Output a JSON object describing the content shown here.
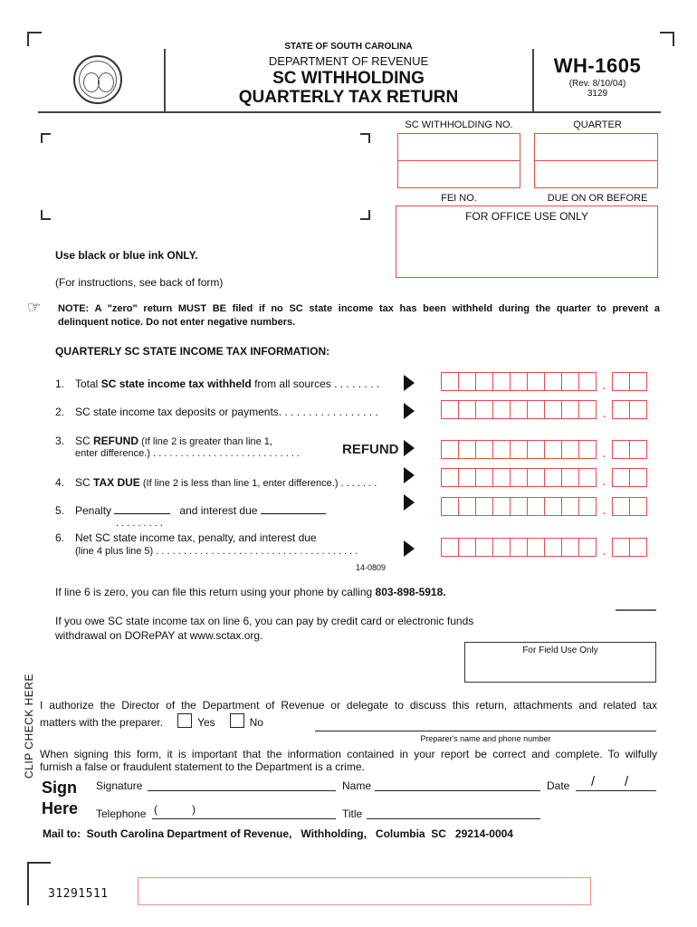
{
  "header": {
    "state": "STATE OF SOUTH CAROLINA",
    "department": "DEPARTMENT OF REVENUE",
    "title_line1": "SC WITHHOLDING",
    "title_line2": "QUARTERLY TAX RETURN",
    "form_number": "WH-1605",
    "revision": "(Rev. 8/10/04)",
    "form_code": "3129",
    "seal_icon": "sc-state-seal"
  },
  "id_boxes": {
    "withholding_no_label": "SC WITHHOLDING NO.",
    "quarter_label": "QUARTER",
    "fei_no_label": "FEI NO.",
    "due_date_label": "DUE ON OR BEFORE",
    "office_use_label": "FOR OFFICE USE ONLY",
    "withholding_no_value": "",
    "quarter_value": "",
    "fei_no_value": "",
    "due_date_value": ""
  },
  "instructions": {
    "ink": "Use black or blue ink ONLY.",
    "see_back": "(For instructions, see back of form)",
    "note_icon": "pointing-hand",
    "note_line1": "NOTE: A \"zero\" return MUST BE filed if no SC state income tax has been  withheld during the quarter to prevent a",
    "note_line2": "delinquent notice.  Do not enter negative numbers.",
    "section_title": "QUARTERLY SC STATE INCOME TAX INFORMATION:"
  },
  "lines": [
    {
      "num": "1.",
      "pre": "Total ",
      "bold": "SC state income tax withheld",
      "post": " from all sources . . . . . . . .",
      "value": ""
    },
    {
      "num": "2.",
      "pre": "SC state income tax deposits or payments. . . . . . . . . . . . . . . . .",
      "bold": "",
      "post": "",
      "value": ""
    },
    {
      "num": "3.",
      "pre": "SC ",
      "bold": "REFUND",
      "post": " (If line 2 is greater than line 1,",
      "line2": "enter difference.) . . . . . . . . . . . . . . . . . . . . . . . . . . .",
      "tag": "REFUND",
      "value": ""
    },
    {
      "num": "4.",
      "pre": "SC ",
      "bold": "TAX DUE",
      "post": " (If line 2 is less than line 1, enter difference.)  . . . . . . .",
      "value": ""
    },
    {
      "num": "5.",
      "pre": "Penalty",
      "mid": "and interest due",
      "dots": ". . . . . . . . .",
      "value": ""
    },
    {
      "num": "6.",
      "pre": "Net SC state income tax, penalty, and interest due",
      "line2": "(line 4 plus line 5) . . . . . . . . . . . . . . . . . . . . . . . . . . . . . . . . . . . . .",
      "value": ""
    }
  ],
  "amount_format": {
    "dollar_cells": 9,
    "cent_cells": 2,
    "separator": "."
  },
  "line_code": "14-0809",
  "phone_filing": {
    "text": "If line 6 is zero, you can file this return using your phone by calling ",
    "phone": "803-898-5918."
  },
  "epay": {
    "line1": "If you owe SC state income tax on line 6, you can pay by credit card or electronic funds",
    "line2": "withdrawal on DORePAY at www.sctax.org."
  },
  "field_use_label": "For Field Use Only",
  "clip_label": "CLIP CHECK HERE",
  "authorization": {
    "line1": "I authorize the Director of the Department of Revenue or delegate to discuss this return, attachments and related tax",
    "line2": "matters with the preparer.",
    "yes_label": "Yes",
    "no_label": "No",
    "yes_checked": false,
    "no_checked": false,
    "preparer_label": "Preparer's name and phone number"
  },
  "signing_notice": {
    "line1": "When signing this form, it is important that the information contained in your report be correct and complete. To wilfully",
    "line2": "furnish a false or fraudulent statement to the Department is a crime."
  },
  "sign": {
    "sign_label": "Sign",
    "here_label": "Here",
    "signature_label": "Signature",
    "name_label": "Name",
    "date_label": "Date",
    "telephone_label": "Telephone",
    "title_label": "Title",
    "date_sep": "/",
    "phone_open": "(",
    "phone_close": ")"
  },
  "mail_to": {
    "label": "Mail to:",
    "address": "South Carolina Department of Revenue,   Withholding,   Columbia  SC   29214-0004"
  },
  "scan_code": "31291511"
}
